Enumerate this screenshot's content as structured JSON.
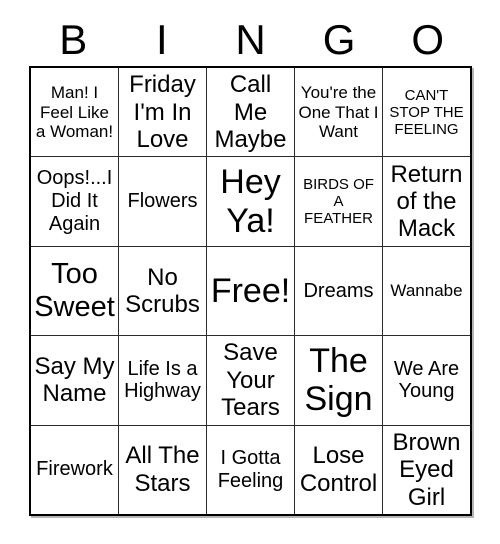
{
  "card": {
    "title": "BINGO",
    "header_letters": [
      "B",
      "I",
      "N",
      "G",
      "O"
    ],
    "colors": {
      "background": "#ffffff",
      "text": "#000000",
      "grid_line": "#2b2b2b",
      "outer_border": "#000000"
    },
    "grid": {
      "columns": 5,
      "rows": 5,
      "free_space_index": {
        "row": 2,
        "col": 2
      }
    },
    "rows": [
      [
        {
          "text": "Man! I Feel Like a Woman!",
          "size": "fs-sm",
          "free": false
        },
        {
          "text": "Friday I'm In Love",
          "size": "fs-lg",
          "free": false
        },
        {
          "text": "Call Me Maybe",
          "size": "fs-lg",
          "free": false
        },
        {
          "text": "You're the One That I Want",
          "size": "fs-sm",
          "free": false
        },
        {
          "text": "CAN'T STOP THE FEELING",
          "size": "fs-xs",
          "free": false
        }
      ],
      [
        {
          "text": "Oops!...I Did It Again",
          "size": "fs-md",
          "free": false
        },
        {
          "text": "Flowers",
          "size": "fs-md",
          "free": false
        },
        {
          "text": "Hey Ya!",
          "size": "fs-xxl",
          "free": false
        },
        {
          "text": "BIRDS OF A FEATHER",
          "size": "fs-xs",
          "free": false
        },
        {
          "text": "Return of the Mack",
          "size": "fs-lg",
          "free": false
        }
      ],
      [
        {
          "text": "Too Sweet",
          "size": "fs-xl",
          "free": false
        },
        {
          "text": "No Scrubs",
          "size": "fs-lg",
          "free": false
        },
        {
          "text": "Free!",
          "size": "fs-xxl",
          "free": true
        },
        {
          "text": "Dreams",
          "size": "fs-md",
          "free": false
        },
        {
          "text": "Wannabe",
          "size": "fs-sm",
          "free": false
        }
      ],
      [
        {
          "text": "Say My Name",
          "size": "fs-lg",
          "free": false
        },
        {
          "text": "Life Is a Highway",
          "size": "fs-md",
          "free": false
        },
        {
          "text": "Save Your Tears",
          "size": "fs-lg",
          "free": false
        },
        {
          "text": "The Sign",
          "size": "fs-xxl",
          "free": false
        },
        {
          "text": "We Are Young",
          "size": "fs-md",
          "free": false
        }
      ],
      [
        {
          "text": "Firework",
          "size": "fs-md",
          "free": false
        },
        {
          "text": "All The Stars",
          "size": "fs-lg",
          "free": false
        },
        {
          "text": "I Gotta Feeling",
          "size": "fs-md",
          "free": false
        },
        {
          "text": "Lose Control",
          "size": "fs-lg",
          "free": false
        },
        {
          "text": "Brown Eyed Girl",
          "size": "fs-lg",
          "free": false
        }
      ]
    ]
  }
}
